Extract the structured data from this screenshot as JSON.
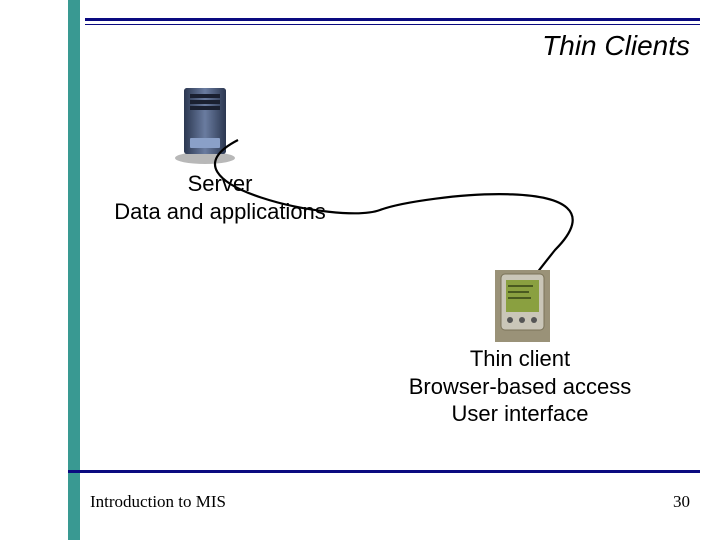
{
  "slide": {
    "title": "Thin Clients",
    "server_label_line1": "Server",
    "server_label_line2": "Data and applications",
    "client_label_line1": "Thin client",
    "client_label_line2": "Browser-based access",
    "client_label_line3": "User interface",
    "footer_left": "Introduction to MIS",
    "page_number": "30"
  },
  "icons": {
    "server": "server-tower-icon",
    "client": "pda-device-icon"
  },
  "colors": {
    "rule": "#0a0a80",
    "stripe": "#399992"
  }
}
